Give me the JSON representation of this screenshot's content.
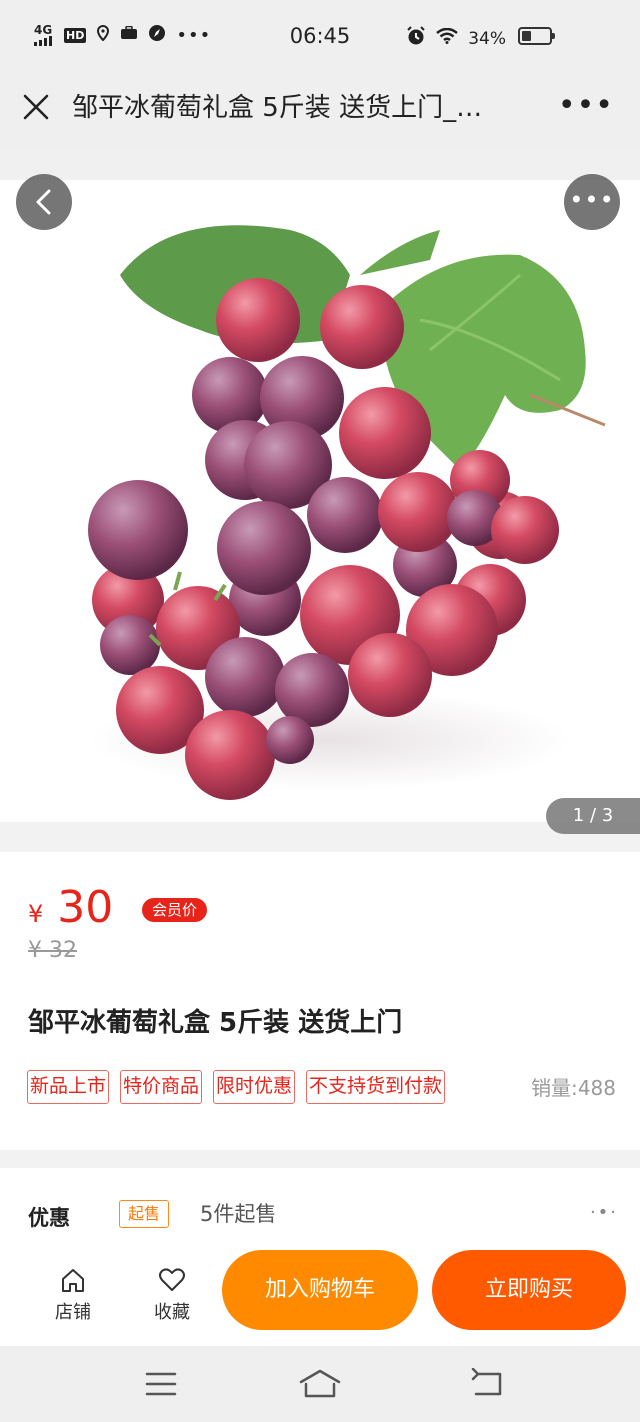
{
  "status_bar": {
    "network": "4G",
    "hd": "HD",
    "time": "06:45",
    "battery": "34%"
  },
  "title_bar": {
    "title": "邹平冰葡萄礼盒 5斤装 送货上门_…"
  },
  "gallery": {
    "counter": "1 / 3"
  },
  "product": {
    "currency": "¥",
    "price": "30",
    "member_tag": "会员价",
    "old_price": "¥ 32",
    "title": "邹平冰葡萄礼盒 5斤装 送货上门",
    "tags": [
      "新品上市",
      "特价商品",
      "限时优惠",
      "不支持货到付款"
    ],
    "sales_label": "销量:",
    "sales_value": "488"
  },
  "promo": {
    "label": "优惠",
    "badge": "起售",
    "text": "5件起售"
  },
  "action_bar": {
    "shop_label": "店铺",
    "favorite_label": "收藏",
    "add_cart_label": "加入购物车",
    "buy_now_label": "立即购买"
  },
  "colors": {
    "price_red": "#e8231a",
    "cart_orange": "#ff8a00",
    "buy_orange": "#ff5a00"
  }
}
